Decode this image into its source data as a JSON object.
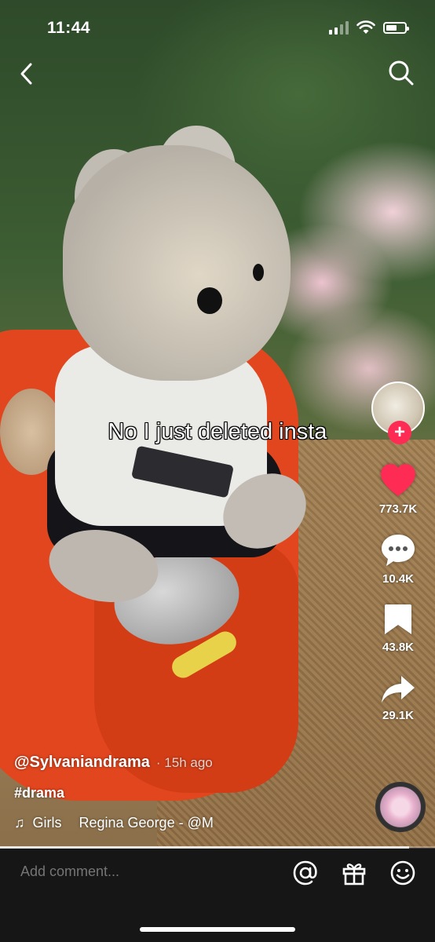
{
  "status_bar": {
    "time": "11:44"
  },
  "video": {
    "caption": "No I just deleted insta",
    "progress_fraction": 0.94
  },
  "creator": {
    "username": "@Sylvaniandrama",
    "posted": "· 15h ago",
    "description": "#drama",
    "music_note": "♫",
    "music_song": "Girls",
    "music_artist": "Regina George - @M"
  },
  "actions": {
    "follow_symbol": "+",
    "likes": "773.7K",
    "comments": "10.4K",
    "saves": "43.8K",
    "shares": "29.1K"
  },
  "comment_bar": {
    "placeholder": "Add comment..."
  },
  "colors": {
    "like": "#fe2c55",
    "follow": "#fe2c55",
    "comment_bar_bg": "#161616"
  },
  "icons": [
    "back-chevron-icon",
    "search-icon",
    "heart-icon",
    "comment-bubble-icon",
    "bookmark-icon",
    "share-arrow-icon",
    "music-note-icon",
    "at-mention-icon",
    "gift-icon",
    "emoji-icon"
  ]
}
